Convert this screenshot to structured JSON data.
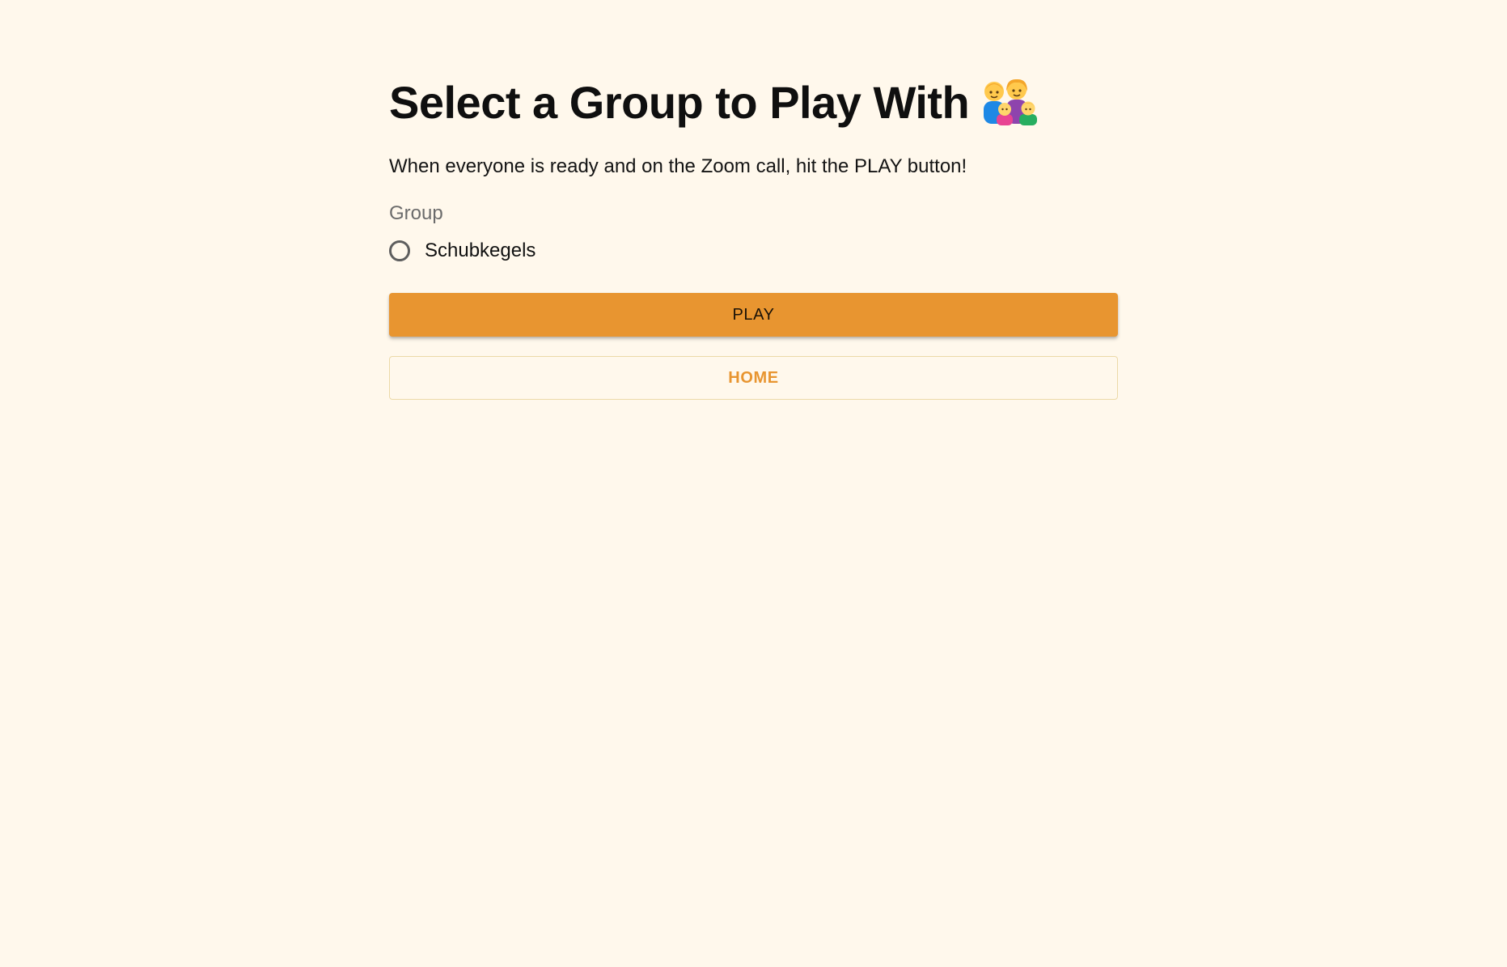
{
  "page": {
    "title": "Select a Group to Play With",
    "title_icon": "family-icon",
    "subtitle": "When everyone is ready and on the Zoom call, hit the PLAY button!"
  },
  "group_field": {
    "label": "Group",
    "options": [
      {
        "label": "Schubkegels",
        "selected": false
      }
    ]
  },
  "actions": {
    "play_label": "PLAY",
    "home_label": "HOME"
  },
  "colors": {
    "background": "#fff8ec",
    "accent": "#e89530",
    "outline": "#ecd9a8"
  }
}
